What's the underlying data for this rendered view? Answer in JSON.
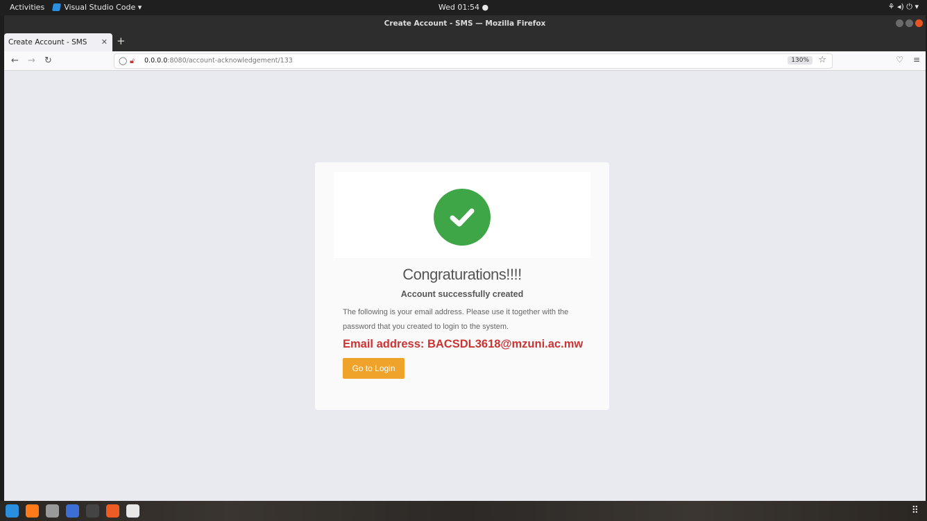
{
  "topbar": {
    "activities": "Activities",
    "app_name": "Visual Studio Code ▾",
    "clock": "Wed 01:54 ●",
    "system_icons": "⚘ ◂) ⏻ ▾"
  },
  "window": {
    "title": "Create Account - SMS — Mozilla Firefox"
  },
  "tabs": [
    {
      "label": "Create Account - SMS"
    }
  ],
  "navbar": {
    "url_host": "0.0.0.0",
    "url_rest": ":8080/account-acknowledgement/133",
    "zoom": "130%"
  },
  "card": {
    "title": "Congraturations!!!!",
    "subtitle": "Account successfully created",
    "paragraph": "The following is your email address. Please use it together with the password that you created to login to the system.",
    "email_line": "Email address: BACSDL3618@mzuni.ac.mw",
    "login_button": "Go to Login"
  },
  "colors": {
    "success": "#3fa648",
    "button": "#f0a32a",
    "email": "#cc3333"
  },
  "dock": {
    "apps": [
      "vscode-icon",
      "firefox-icon",
      "files-icon",
      "vscode-insiders-icon",
      "terminal-icon",
      "postman-icon",
      "text-editor-icon"
    ],
    "app_colors": [
      "#2b8fe0",
      "#ff7a1a",
      "#9a9a9a",
      "#3b6fd4",
      "#444444",
      "#ef5b25",
      "#e8e8e8"
    ]
  }
}
